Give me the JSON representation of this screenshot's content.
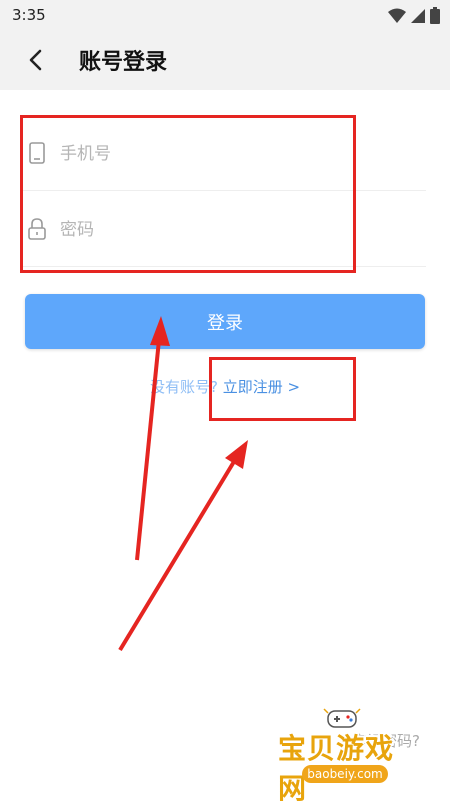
{
  "status_bar": {
    "time": "3:35",
    "icons": [
      "wifi-icon",
      "signal-icon",
      "battery-icon"
    ]
  },
  "header": {
    "back_icon": "back-arrow-icon",
    "title": "账号登录"
  },
  "form": {
    "phone": {
      "placeholder": "手机号",
      "value": "",
      "icon": "phone-icon"
    },
    "password": {
      "placeholder": "密码",
      "value": "",
      "icon": "lock-icon"
    }
  },
  "login_button": {
    "label": "登录",
    "color": "#5ea7fb"
  },
  "register": {
    "question": "没有账号?",
    "link_label": "立即注册 >"
  },
  "forgot_password": {
    "label": "忘记密码?"
  },
  "watermark": {
    "name": "宝贝游戏网",
    "url": "baobeiy.com"
  },
  "colors": {
    "annotation": "#e52521",
    "link": "#4a90e2"
  }
}
